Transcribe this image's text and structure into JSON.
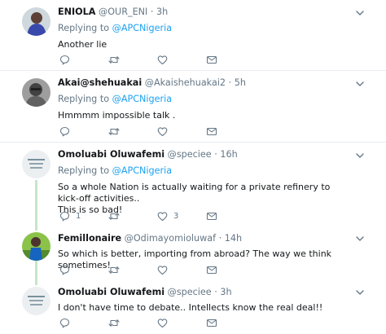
{
  "tweets": [
    {
      "name": "ENIOLA",
      "handle": "@OUR_ENI",
      "dot": "·",
      "time": "3h",
      "reply_prefix": "Replying to ",
      "reply_to": "@APCNigeria",
      "lines": [
        "Another lie"
      ],
      "replies": "",
      "likes": ""
    },
    {
      "name": "Akai@shehuakai",
      "handle": "@Akaishehuakai2",
      "dot": "·",
      "time": "5h",
      "reply_prefix": "Replying to ",
      "reply_to": "@APCNigeria",
      "lines": [
        "Hmmmm impossible talk ."
      ],
      "replies": "",
      "likes": ""
    },
    {
      "name": "Omoluabi Oluwafemi",
      "handle": "@speciee",
      "dot": "·",
      "time": "16h",
      "reply_prefix": "Replying to ",
      "reply_to": "@APCNigeria",
      "lines": [
        "So a whole Nation is actually waiting for a private refinery to kick-off activities..",
        "This is so bad!"
      ],
      "replies": "1",
      "likes": "3"
    },
    {
      "name": "Femillonaire",
      "handle": "@Odimayomioluwaf",
      "dot": "·",
      "time": "14h",
      "reply_prefix": "",
      "reply_to": "",
      "lines": [
        "So which is better, importing from abroad? The way we think sometimes!"
      ],
      "replies": "",
      "likes": ""
    },
    {
      "name": "Omoluabi Oluwafemi",
      "handle": "@speciee",
      "dot": "·",
      "time": "3h",
      "reply_prefix": "",
      "reply_to": "",
      "lines": [
        "I don't have time to debate.. Intellects know the real deal!!"
      ],
      "replies": "",
      "likes": ""
    }
  ],
  "icons": {
    "reply": "reply-icon",
    "retweet": "retweet-icon",
    "like": "heart-icon",
    "message": "envelope-icon",
    "more": "chevron-down-icon"
  },
  "colors": {
    "mention": "#1da1f2",
    "secondary_text": "#657786",
    "thread_line": "#c4e6c8",
    "divider": "#e6ecf0"
  }
}
